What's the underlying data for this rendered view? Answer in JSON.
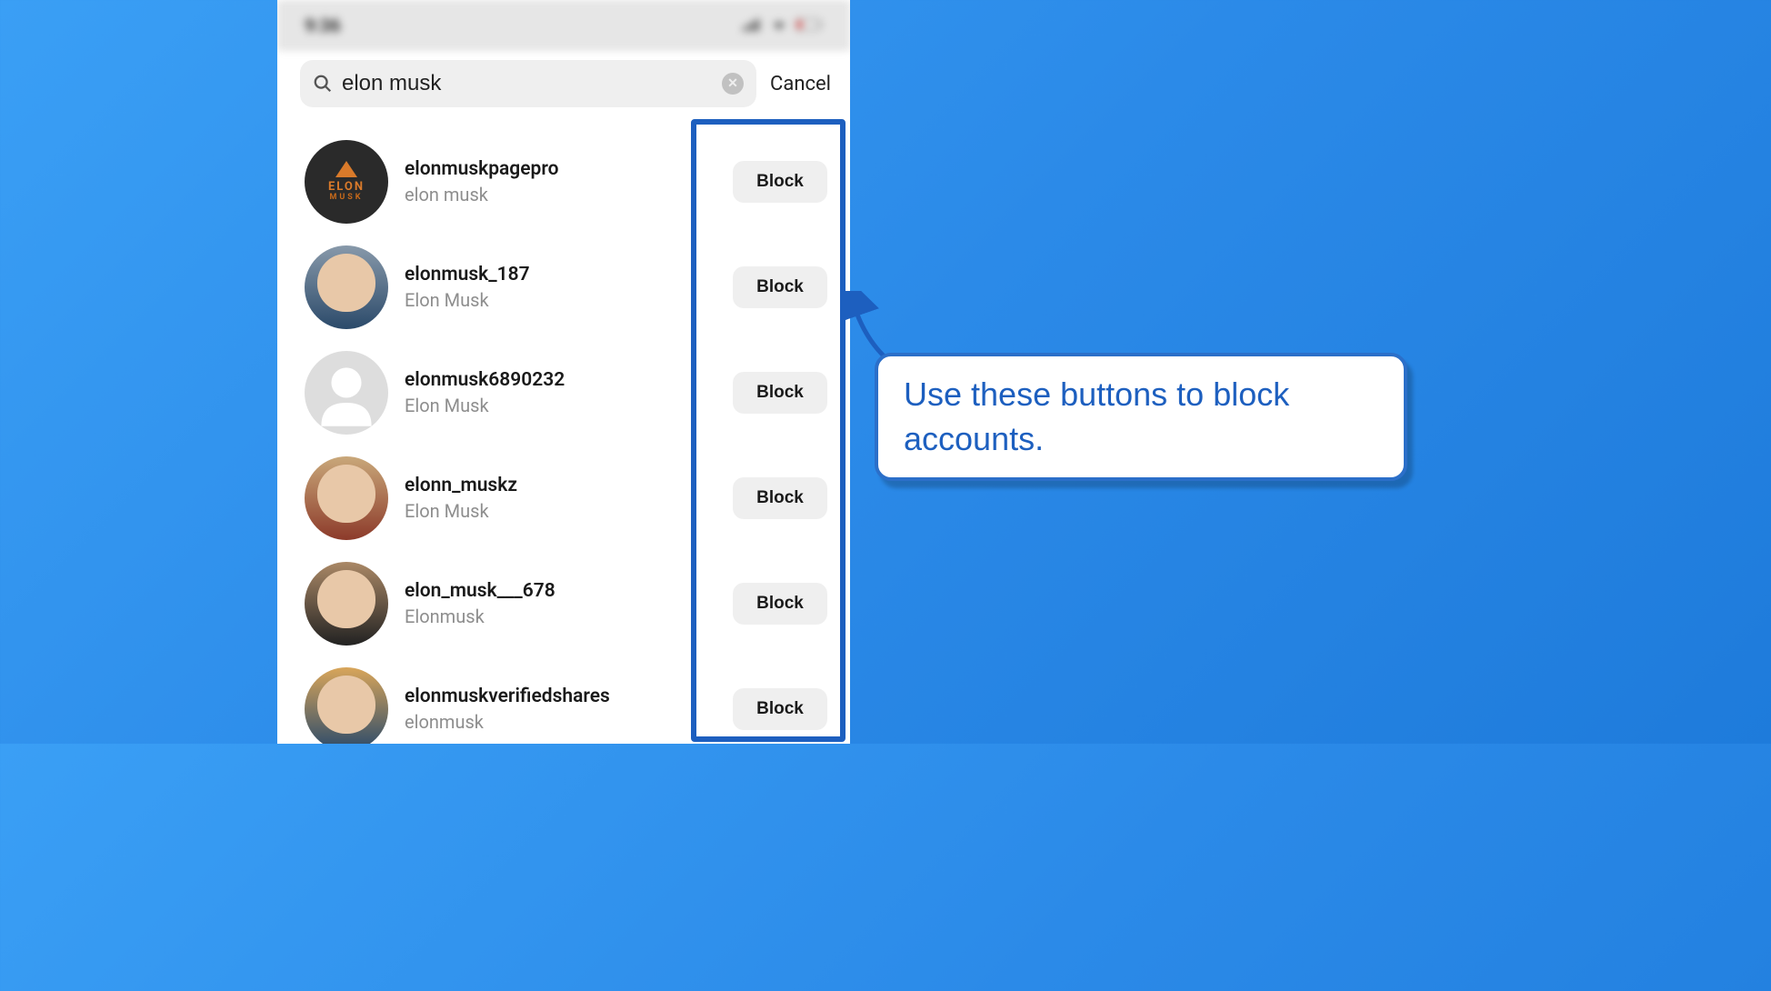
{
  "status_bar": {
    "time": "9:36"
  },
  "search": {
    "query": "elon musk",
    "cancel_label": "Cancel"
  },
  "block_label": "Block",
  "results": [
    {
      "username": "elonmuskpagepro",
      "display_name": "elon musk"
    },
    {
      "username": "elonmusk_187",
      "display_name": "Elon Musk"
    },
    {
      "username": "elonmusk6890232",
      "display_name": "Elon Musk"
    },
    {
      "username": "elonn_muskz",
      "display_name": "Elon Musk"
    },
    {
      "username": "elon_musk___678",
      "display_name": "Elonmusk"
    },
    {
      "username": "elonmuskverifiedshares",
      "display_name": "elonmusk"
    }
  ],
  "callout": {
    "text": "Use these buttons to block accounts."
  }
}
